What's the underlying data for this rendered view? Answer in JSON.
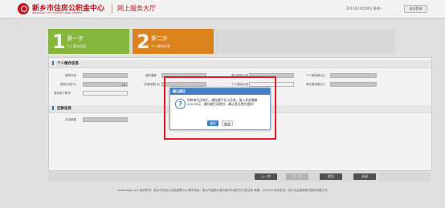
{
  "header": {
    "brand": "新乡市住房公积金中心",
    "brand_en": "XINXIANG CITY HOUSE FUND CENTER",
    "system_name": "网上服务大厅",
    "date_text": "2015年10月09日 星期一",
    "logout_label": "退出登录",
    "logo_color": "#c8171e"
  },
  "steps": [
    {
      "num": "1",
      "title": "第一步",
      "sub": "个人基本信息",
      "color": "#8cc13f"
    },
    {
      "num": "2",
      "title": "第二步",
      "sub": "个人缴存信息",
      "color": "#e8891c"
    }
  ],
  "sections": {
    "personal": {
      "title": "个人缴存信息",
      "fields": {
        "f1": "缴存状态",
        "f2": "缴存基数",
        "f3": "单位缴存比例",
        "f4": "个人缴存额(元)",
        "f5": "缴存比例(%)",
        "f5_value": "24",
        "f6": "月缴存额(元)",
        "f7": "个人缴存比例",
        "f8": "单位缴存额(元)",
        "f9": "缴存账户账号"
      }
    },
    "repay": {
      "title": "还款信息",
      "fields": {
        "r1": "月还款额"
      }
    }
  },
  "pager": {
    "prev": "上一步",
    "next": "下一步",
    "submit": "提交",
    "close": "关闭"
  },
  "footer": "www.xxgjj.com 版权所有：新乡市住房公积金管理中心 联系地址：新乡市金穗大道与新中大道交叉口西北角 邮编：453000 技术支持：四川久远银海软件股份有限公司",
  "dialog": {
    "title": "确认提示",
    "icon": "question-icon",
    "message": "贷款每月还款后，缴存额不足以还款，请入资金缴额400.00元，缴存额后再提交，确认是否提交通知！",
    "ok": "确定",
    "cancel": "取消",
    "accent": "#3f7fc6"
  }
}
